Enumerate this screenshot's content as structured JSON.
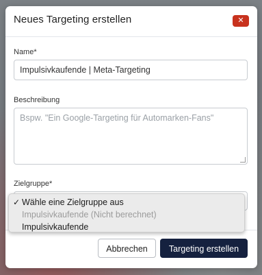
{
  "modal": {
    "title": "Neues Targeting erstellen",
    "close_label": "✕"
  },
  "form": {
    "name_label": "Name*",
    "name_value": "Impulsivkaufende | Meta-Targeting",
    "description_label": "Beschreibung",
    "description_placeholder": "Bspw. \"Ein Google-Targeting für Automarken-Fans\"",
    "audience_label": "Zielgruppe*"
  },
  "dropdown": {
    "options": [
      {
        "label": "Wähle eine Zielgruppe aus",
        "selected": true,
        "disabled": false
      },
      {
        "label": "Impulsivkaufende (Nicht berechnet)",
        "selected": false,
        "disabled": true
      },
      {
        "label": "Impulsivkaufende",
        "selected": false,
        "disabled": false
      }
    ],
    "check_glyph": "✓"
  },
  "footer": {
    "cancel_label": "Abbrechen",
    "submit_label": "Targeting erstellen"
  },
  "colors": {
    "close_button": "#c8321e",
    "primary_button": "#15213f"
  }
}
